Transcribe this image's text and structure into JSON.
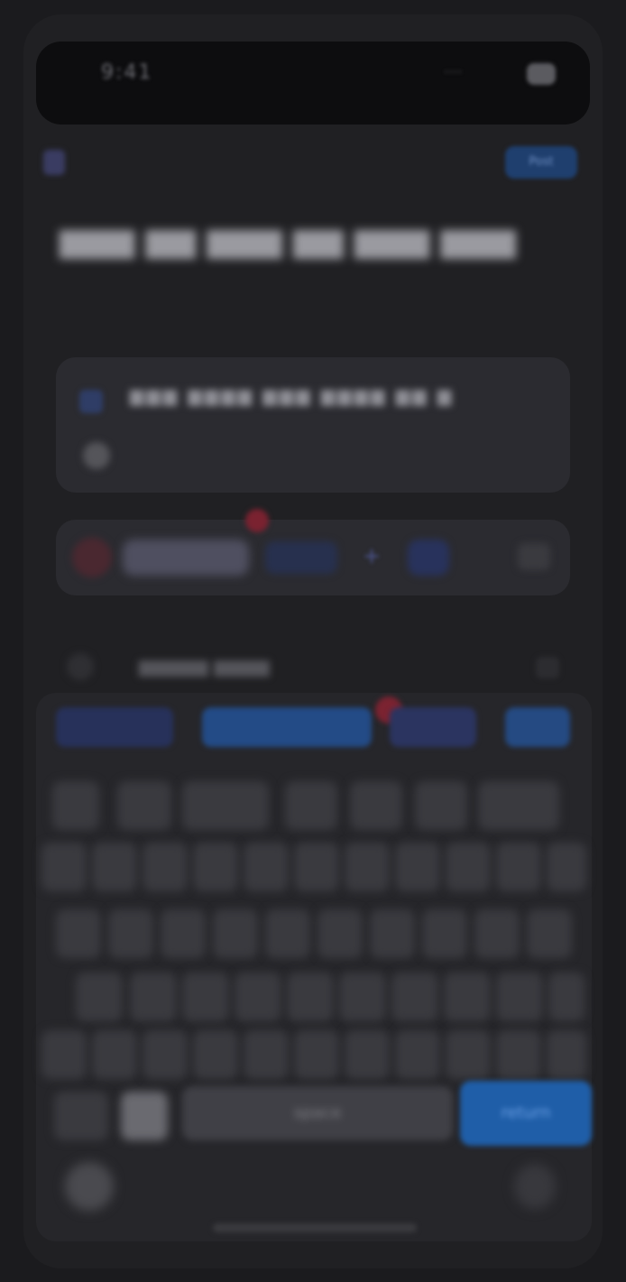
{
  "status_bar": {
    "time": "9:41",
    "carrier": "···· ",
    "battery_label": ""
  },
  "nav": {
    "back_label": "‹",
    "action_label": "Post"
  },
  "headline": {
    "text": "▆▆▆ ▆▆ ▆▆▆ ▆▆ ▆▆▆ ▆▆▆"
  },
  "composer": {
    "placeholder": "▆▆▆ ▆▆▆▆ ▆▆▆ ▆▆▆▆ ▆▆ ▆"
  },
  "toolbar": {
    "plus_label": "+"
  },
  "suggestion": {
    "text": "▆▆▆▆▆ ▆▆▆▆"
  },
  "keyboard": {
    "space_label": "space",
    "enter_label": "return"
  },
  "colors": {
    "background": "#1b1b1e",
    "accent": "#1f5ea8",
    "badge": "#7b2331"
  }
}
